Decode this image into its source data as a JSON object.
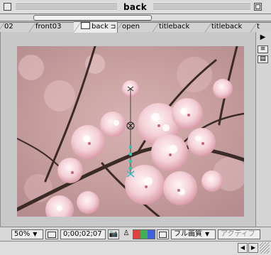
{
  "window": {
    "title": "back"
  },
  "tabs": [
    {
      "label": "02"
    },
    {
      "label": "front03"
    },
    {
      "label": "back",
      "active": true
    },
    {
      "label": "open"
    },
    {
      "label": "titleback"
    },
    {
      "label": "titleback"
    },
    {
      "label": "t"
    }
  ],
  "status": {
    "zoom": "50%",
    "timecode": "0;00;02;07",
    "resolution": "フル画質",
    "active_label": "アクティブ"
  },
  "icons": {
    "safe_area": "safe-area-icon",
    "snapshot": "camera-icon",
    "channel": "channel-icon",
    "region": "region-icon"
  },
  "colors": {
    "photo_bg": "#c49a97",
    "channel_red": "#e04040",
    "channel_green": "#40b050",
    "channel_blue": "#4060e0"
  }
}
